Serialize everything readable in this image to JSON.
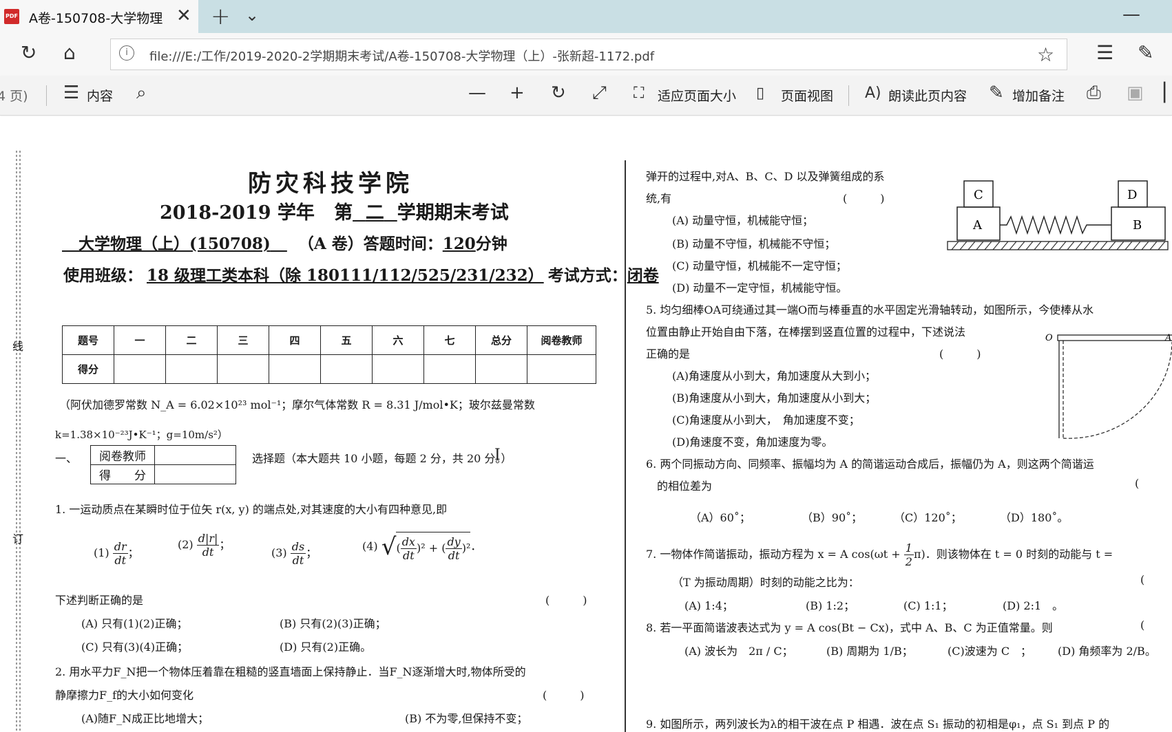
{
  "browser": {
    "tab_title": "A卷-150708-大学物理",
    "tab_icon": "PDF",
    "url": "file:///E:/工作/2019-2020-2学期期末考试/A卷-150708-大学物理（上）-张新超-1172.pdf"
  },
  "pdf_toolbar": {
    "page_count": "4 页)",
    "contents": "内容",
    "fit_page": "适应页面大小",
    "page_view": "页面视图",
    "read_aloud": "朗读此页内容",
    "add_notes": "增加备注"
  },
  "document": {
    "school": "防灾科技学院",
    "term_line1": "2018-2019 学年",
    "term_line2": "第",
    "term_num": "二",
    "term_line3": "学期期末考试",
    "course": "大学物理（上）(150708)",
    "paper_info": "（A 卷）答题时间：",
    "minutes": "120",
    "minutes_unit": "分钟",
    "class_label": "使用班级：",
    "class_value": "18 级理工类本科（除 180111/112/525/231/232）",
    "exam_mode_label": "考试方式：",
    "exam_mode_value": "闭卷",
    "score_table": {
      "header": [
        "题号",
        "一",
        "二",
        "三",
        "四",
        "五",
        "六",
        "七",
        "总分",
        "阅卷教师"
      ],
      "row_label": "得分"
    },
    "constants_line1": "（阿伏加德罗常数 N_A = 6.02×10²³ mol⁻¹；摩尔气体常数 R = 8.31 J/mol•K；玻尔兹曼常数",
    "constants_line2": "k=1.38×10⁻²³J•K⁻¹；g=10m/s²）",
    "section_num": "一、",
    "reviewer_label": "阅卷教师",
    "score_label": "得　　分",
    "section_desc": "选择题（本大题共 10 小题，每题 2 分，共 20 分。）",
    "left_side_marks": [
      "线",
      "订"
    ],
    "q1_stem": "1. 一运动质点在某瞬时位于位矢 r(x, y) 的端点处,对其速度的大小有四种意见,即",
    "q1_opt1_label": "(1)",
    "q1_opt2_label": "(2)",
    "q1_opt3_label": "(3)",
    "q1_opt4_label": "(4)",
    "q1_judge": "下述判断正确的是",
    "blank_paren": "(　　　)",
    "q1_A": "(A)  只有(1)(2)正确；",
    "q1_B": "(B)  只有(2)(3)正确；",
    "q1_C": "(C)  只有(3)(4)正确；",
    "q1_D": "(D)  只有(2)正确。",
    "q2_stem": "2. 用水平力F_N把一个物体压着靠在粗糙的竖直墙面上保持静止．当F_N逐渐增大时,物体所受的",
    "q2_stem2": "静摩擦力F_f的大小如何变化",
    "q2_A": "(A)随F_N成正比地增大；",
    "q2_B": "(B)  不为零,但保持不变；",
    "q4_cont": "弹开的过程中,对A、B、C、D 以及弹簧组成的系",
    "q4_cont2": "统,有",
    "q4_A": "(A)  动量守恒，机械能守恒；",
    "q4_B": "(B)  动量不守恒，机械能不守恒；",
    "q4_C": "(C)  动量守恒，机械能不一定守恒；",
    "q4_D": "(D)  动量不一定守恒，机械能守恒。",
    "fig4_labels": [
      "C",
      "A",
      "D",
      "B"
    ],
    "q5_stem": "5. 均匀细棒OA可绕通过其一端O而与棒垂直的水平固定光滑轴转动，如图所示，今使棒从水",
    "q5_stem2": "位置由静止开始自由下落，在棒摆到竖直位置的过程中，下述说法",
    "q5_stem3": "正确的是",
    "q5_A": "(A)角速度从小到大，角加速度从大到小；",
    "q5_B": "(B)角速度从小到大，角加速度从小到大；",
    "q5_C": "(C)角速度从小到大，　角加速度不变；",
    "q5_D": "(D)角速度不变，角加速度为零。",
    "fig5_labels": [
      "O",
      "A"
    ],
    "q6_stem": "6. 两个同振动方向、同频率、振幅均为 A 的简谐运动合成后，振幅仍为 A，则这两个简谐运",
    "q6_stem2": "的相位差为",
    "q6_paren": "(",
    "q6_A": "（A）60˚；",
    "q6_B": "（B）90˚；",
    "q6_C": "（C）120˚；",
    "q6_D": "（D）180˚。",
    "q7_stem_a": "7. 一物体作简谐振动，振动方程为 x = A cos(ωt + ",
    "q7_frac_n": "1",
    "q7_frac_d": "2",
    "q7_stem_b": "π)．则该物体在 t = 0 时刻的动能与 t = ",
    "q7_stem2": "（T 为振动周期）时刻的动能之比为：",
    "q7_paren": "(",
    "q7_A": "(A) 1:4；",
    "q7_B": "(B) 1:2；",
    "q7_C": "(C) 1:1；",
    "q7_D": "(D) 2:1　。",
    "q8_stem": "8. 若一平面简谐波表达式为 y = A cos(Bt − Cx)，式中 A、B、C 为正值常量。则",
    "q8_paren": "(",
    "q8_A": "(A)  波长为　2π / C；",
    "q8_B": "(B)  周期为 1/B；",
    "q8_C": "(C)波速为 C　；",
    "q8_D": "(D)  角频率为 2/B。",
    "q9_stem": "9. 如图所示，两列波长为λ的相干波在点 P 相遇．波在点 S₁ 振动的初相是φ₁，点 S₁ 到点 P 的"
  },
  "colors": {
    "tabbar_bg": "#c9dfe4",
    "pdf_icon": "#d12a2a"
  }
}
